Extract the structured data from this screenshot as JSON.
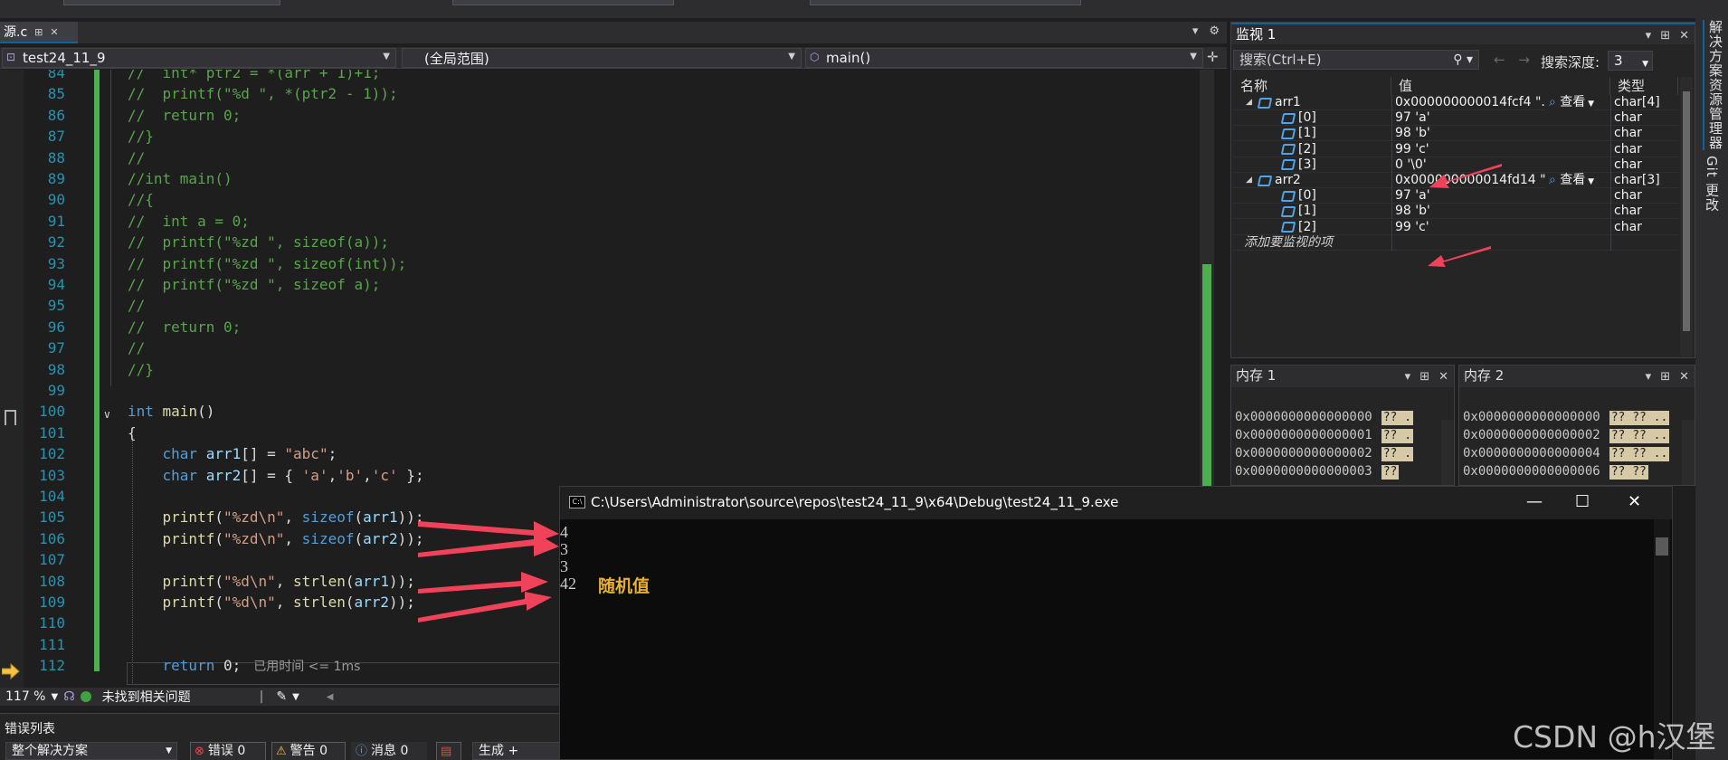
{
  "editor": {
    "tab": {
      "label": "源.c",
      "pin": "⊞",
      "close": "✕"
    },
    "nav": {
      "project": "test24_11_9",
      "scope": "(全局范围)",
      "function": "main()"
    },
    "lines": [
      {
        "n": "84",
        "parts": [
          {
            "t": "//  int* ptr2 = *(arr + 1)+1;",
            "c": "c-com"
          }
        ]
      },
      {
        "n": "85",
        "parts": [
          {
            "t": "//  printf(\"%d \", *(ptr2 - 1));",
            "c": "c-com"
          }
        ]
      },
      {
        "n": "86",
        "parts": [
          {
            "t": "//  return 0;",
            "c": "c-com"
          }
        ]
      },
      {
        "n": "87",
        "parts": [
          {
            "t": "//}",
            "c": "c-com"
          }
        ]
      },
      {
        "n": "88",
        "parts": [
          {
            "t": "//",
            "c": "c-com"
          }
        ]
      },
      {
        "n": "89",
        "parts": [
          {
            "t": "//int main()",
            "c": "c-com"
          }
        ]
      },
      {
        "n": "90",
        "parts": [
          {
            "t": "//{",
            "c": "c-com"
          }
        ]
      },
      {
        "n": "91",
        "parts": [
          {
            "t": "//  int a = 0;",
            "c": "c-com"
          }
        ]
      },
      {
        "n": "92",
        "parts": [
          {
            "t": "//  printf(\"%zd \", sizeof(a));",
            "c": "c-com"
          }
        ]
      },
      {
        "n": "93",
        "parts": [
          {
            "t": "//  printf(\"%zd \", sizeof(int));",
            "c": "c-com"
          }
        ]
      },
      {
        "n": "94",
        "parts": [
          {
            "t": "//  printf(\"%zd \", sizeof a);",
            "c": "c-com"
          }
        ]
      },
      {
        "n": "95",
        "parts": [
          {
            "t": "//",
            "c": "c-com"
          }
        ]
      },
      {
        "n": "96",
        "parts": [
          {
            "t": "//  return 0;",
            "c": "c-com"
          }
        ]
      },
      {
        "n": "97",
        "parts": [
          {
            "t": "//",
            "c": "c-com"
          }
        ]
      },
      {
        "n": "98",
        "parts": [
          {
            "t": "//}",
            "c": "c-com"
          }
        ]
      },
      {
        "n": "99",
        "parts": []
      },
      {
        "n": "100",
        "parts": [
          {
            "t": "int",
            "c": "c-kw"
          },
          {
            "t": " main",
            "c": "c-fn"
          },
          {
            "t": "()",
            "c": "c-txt"
          }
        ]
      },
      {
        "n": "101",
        "parts": [
          {
            "t": "{",
            "c": "c-txt"
          }
        ]
      },
      {
        "n": "102",
        "parts": [
          {
            "t": "    char",
            "c": "c-kw"
          },
          {
            "t": " arr1",
            "c": "c-var"
          },
          {
            "t": "[] = ",
            "c": "c-txt"
          },
          {
            "t": "\"abc\"",
            "c": "c-str"
          },
          {
            "t": ";",
            "c": "c-txt"
          }
        ]
      },
      {
        "n": "103",
        "parts": [
          {
            "t": "    char",
            "c": "c-kw"
          },
          {
            "t": " arr2",
            "c": "c-var"
          },
          {
            "t": "[] = { ",
            "c": "c-txt"
          },
          {
            "t": "'a'",
            "c": "c-str"
          },
          {
            "t": ",",
            "c": "c-txt"
          },
          {
            "t": "'b'",
            "c": "c-str"
          },
          {
            "t": ",",
            "c": "c-txt"
          },
          {
            "t": "'c'",
            "c": "c-str"
          },
          {
            "t": " };",
            "c": "c-txt"
          }
        ]
      },
      {
        "n": "104",
        "parts": []
      },
      {
        "n": "105",
        "parts": [
          {
            "t": "    printf",
            "c": "c-fn"
          },
          {
            "t": "(",
            "c": "c-txt"
          },
          {
            "t": "\"%zd\\n\"",
            "c": "c-str"
          },
          {
            "t": ", ",
            "c": "c-txt"
          },
          {
            "t": "sizeof",
            "c": "c-kw"
          },
          {
            "t": "(",
            "c": "c-txt"
          },
          {
            "t": "arr1",
            "c": "c-var"
          },
          {
            "t": "));",
            "c": "c-txt"
          }
        ]
      },
      {
        "n": "106",
        "parts": [
          {
            "t": "    printf",
            "c": "c-fn"
          },
          {
            "t": "(",
            "c": "c-txt"
          },
          {
            "t": "\"%zd\\n\"",
            "c": "c-str"
          },
          {
            "t": ", ",
            "c": "c-txt"
          },
          {
            "t": "sizeof",
            "c": "c-kw"
          },
          {
            "t": "(",
            "c": "c-txt"
          },
          {
            "t": "arr2",
            "c": "c-var"
          },
          {
            "t": "));",
            "c": "c-txt"
          }
        ]
      },
      {
        "n": "107",
        "parts": []
      },
      {
        "n": "108",
        "parts": [
          {
            "t": "    printf",
            "c": "c-fn"
          },
          {
            "t": "(",
            "c": "c-txt"
          },
          {
            "t": "\"%d\\n\"",
            "c": "c-str"
          },
          {
            "t": ", ",
            "c": "c-txt"
          },
          {
            "t": "strlen",
            "c": "c-fn"
          },
          {
            "t": "(",
            "c": "c-txt"
          },
          {
            "t": "arr1",
            "c": "c-var"
          },
          {
            "t": "));",
            "c": "c-txt"
          }
        ]
      },
      {
        "n": "109",
        "parts": [
          {
            "t": "    printf",
            "c": "c-fn"
          },
          {
            "t": "(",
            "c": "c-txt"
          },
          {
            "t": "\"%d\\n\"",
            "c": "c-str"
          },
          {
            "t": ", ",
            "c": "c-txt"
          },
          {
            "t": "strlen",
            "c": "c-fn"
          },
          {
            "t": "(",
            "c": "c-txt"
          },
          {
            "t": "arr2",
            "c": "c-var"
          },
          {
            "t": "));",
            "c": "c-txt"
          }
        ]
      },
      {
        "n": "110",
        "parts": []
      },
      {
        "n": "111",
        "parts": []
      },
      {
        "n": "112",
        "parts": [
          {
            "t": "    return",
            "c": "c-kw"
          },
          {
            "t": " 0;",
            "c": "c-txt"
          }
        ],
        "hint": "已用时间 <= 1ms"
      }
    ],
    "status": {
      "zoom": "117 %",
      "issues": "未找到相关问题"
    }
  },
  "error_list": {
    "title": "错误列表",
    "scope": "整个解决方案",
    "errors": "错误 0",
    "warnings": "警告 0",
    "messages": "消息 0",
    "build": "生成 + IntelliSense"
  },
  "watch": {
    "title": "监视 1",
    "search_placeholder": "搜索(Ctrl+E)",
    "depth_label": "搜索深度:",
    "depth_value": "3",
    "columns": {
      "name": "名称",
      "value": "值",
      "type": "类型"
    },
    "rows": [
      {
        "name": "arr1",
        "value": "0x000000000014fcf4 \"...",
        "type": "char[4]",
        "level": 0,
        "view": "查看"
      },
      {
        "name": "[0]",
        "value": "97 'a'",
        "type": "char",
        "level": 1
      },
      {
        "name": "[1]",
        "value": "98 'b'",
        "type": "char",
        "level": 1
      },
      {
        "name": "[2]",
        "value": "99 'c'",
        "type": "char",
        "level": 1
      },
      {
        "name": "[3]",
        "value": "0 '\\0'",
        "type": "char",
        "level": 1
      },
      {
        "name": "arr2",
        "value": "0x000000000014fd14 \"...",
        "type": "char[3]",
        "level": 0,
        "view": "查看"
      },
      {
        "name": "[0]",
        "value": "97 'a'",
        "type": "char",
        "level": 1
      },
      {
        "name": "[1]",
        "value": "98 'b'",
        "type": "char",
        "level": 1
      },
      {
        "name": "[2]",
        "value": "99 'c'",
        "type": "char",
        "level": 1
      }
    ],
    "add_watch": "添加要监视的项"
  },
  "memory1": {
    "title": "内存 1",
    "rows": [
      {
        "addr": "0x0000000000000000",
        "cells": "?? ."
      },
      {
        "addr": "0x0000000000000001",
        "cells": "?? ."
      },
      {
        "addr": "0x0000000000000002",
        "cells": "?? ."
      },
      {
        "addr": "0x0000000000000003",
        "cells": "??"
      }
    ]
  },
  "memory2": {
    "title": "内存 2",
    "rows": [
      {
        "addr": "0x0000000000000000",
        "cells": "?? ?? .."
      },
      {
        "addr": "0x0000000000000002",
        "cells": "?? ?? .."
      },
      {
        "addr": "0x0000000000000004",
        "cells": "?? ?? .."
      },
      {
        "addr": "0x0000000000000006",
        "cells": "?? ??"
      }
    ]
  },
  "side_tabs": [
    "解决方案资源管理器",
    "Git 更改"
  ],
  "console": {
    "title": "C:\\Users\\Administrator\\source\\repos\\test24_11_9\\x64\\Debug\\test24_11_9.exe",
    "output": [
      "4",
      "3",
      "3",
      "42"
    ],
    "note": "随机值"
  },
  "watermark": "CSDN @h汉堡",
  "colors": {
    "accent": "#0e639c",
    "arrow": "#f0435a",
    "note": "#e8b030",
    "change_bar": "#4caf50"
  }
}
